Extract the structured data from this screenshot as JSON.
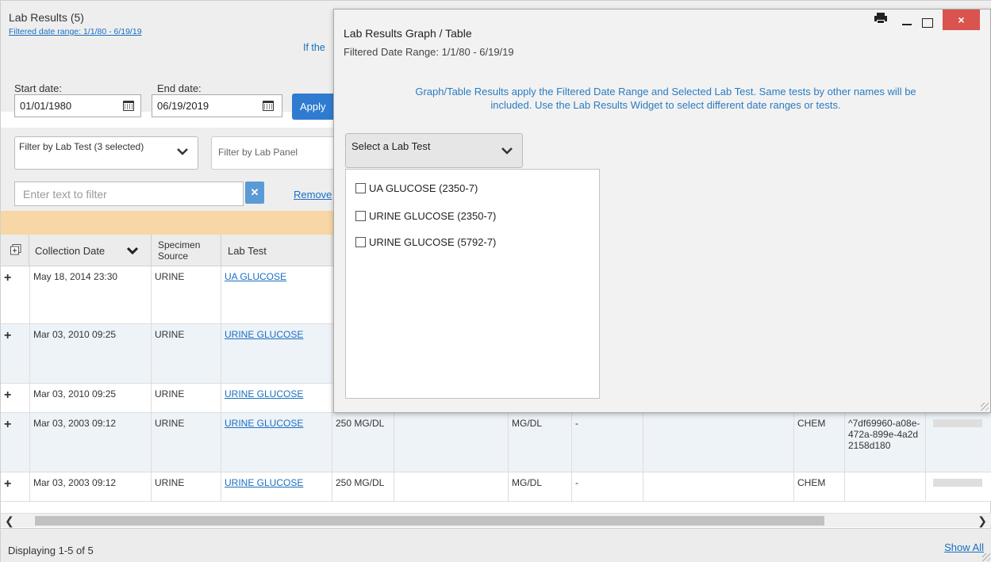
{
  "widget": {
    "title": "Lab Results (5)",
    "filtered_range_link": "Filtered date range: 1/1/80 - 6/19/19",
    "if_the_text": "If the",
    "start_date_label": "Start date:",
    "start_date_value": "01/01/1980",
    "end_date_label": "End date:",
    "end_date_value": "06/19/2019",
    "apply_label": "Apply",
    "filter_lab_test": "Filter by Lab Test (3 selected)",
    "filter_lab_panel": "Filter by Lab Panel",
    "text_filter_placeholder": "Enter text to filter",
    "remove_label": "Remove",
    "icons": {
      "calendar": "calendar-icon",
      "chevron": "chevron-down-icon",
      "clear": "close-icon",
      "expand_all": "expand-all-icon",
      "row_expand": "plus-icon"
    }
  },
  "table": {
    "headers": {
      "collection_date": "Collection Date",
      "specimen_source": "Specimen Source",
      "lab_test": "Lab Test"
    },
    "rows": [
      {
        "date": "May 18, 2014 23:30",
        "source": "URINE",
        "test": "UA GLUCOSE",
        "result": "",
        "units": "",
        "flag": "",
        "facility": "",
        "id": ""
      },
      {
        "date": "Mar 03, 2010 09:25",
        "source": "URINE",
        "test": "URINE GLUCOSE",
        "result": "",
        "units": "",
        "flag": "",
        "facility": "",
        "id": ""
      },
      {
        "date": "Mar 03, 2010 09:25",
        "source": "URINE",
        "test": "URINE GLUCOSE",
        "result": "",
        "units": "",
        "flag": "",
        "facility": "",
        "id": ""
      },
      {
        "date": "Mar 03, 2003 09:12",
        "source": "URINE",
        "test": "URINE GLUCOSE",
        "result": "250 MG/DL",
        "units": "MG/DL",
        "flag": "-",
        "facility": "CHEM",
        "id": "^7df69960-a08e-472a-899e-4a2d2158d180"
      },
      {
        "date": "Mar 03, 2003 09:12",
        "source": "URINE",
        "test": "URINE GLUCOSE",
        "result": "250 MG/DL",
        "units": "MG/DL",
        "flag": "-",
        "facility": "CHEM",
        "id": ""
      }
    ]
  },
  "footer": {
    "displaying": "Displaying 1-5 of 5",
    "show_all": "Show All"
  },
  "modal": {
    "title": "Lab Results Graph / Table",
    "subtitle": "Filtered Date Range: 1/1/80 - 6/19/19",
    "info_line1": "Graph/Table Results apply the Filtered Date Range and Selected Lab Test. Same tests by other names will be",
    "info_line2": "included. Use the Lab Results Widget to select different date ranges or tests.",
    "select_label": "Select a Lab Test",
    "options": [
      "UA GLUCOSE (2350-7)",
      "URINE GLUCOSE (2350-7)",
      "URINE GLUCOSE (5792-7)"
    ],
    "close_glyph": "×",
    "icons": {
      "print": "print-icon",
      "minimize": "minimize-icon",
      "maximize": "maximize-icon",
      "close": "close-icon"
    }
  },
  "colors": {
    "link": "#1a6fc1",
    "primary_button": "#2f7bd0",
    "close_button": "#d9534f",
    "alert_bar": "#f7d7a5"
  }
}
